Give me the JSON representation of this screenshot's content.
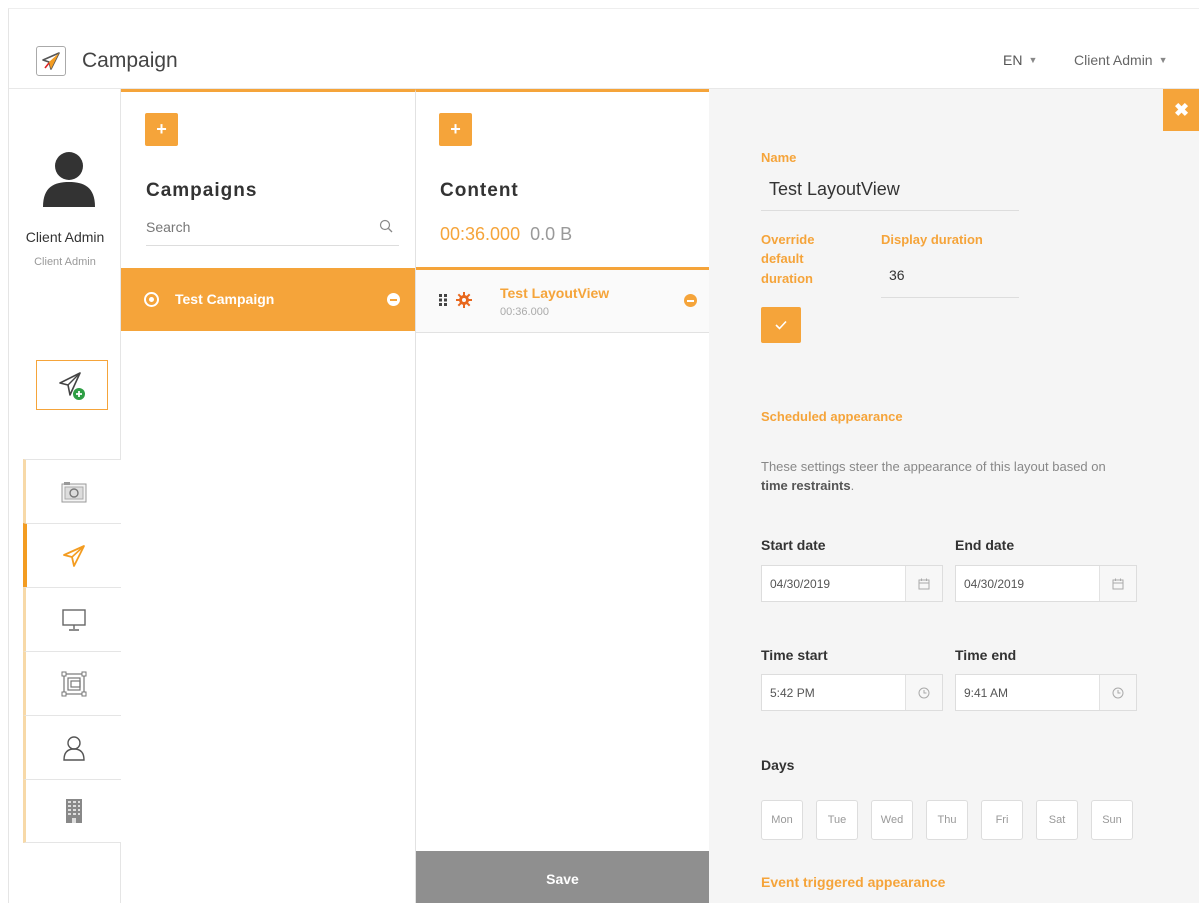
{
  "header": {
    "app_title": "Campaign",
    "language": "EN",
    "user_menu": "Client Admin"
  },
  "sidebar": {
    "user_name": "Client Admin",
    "user_role": "Client Admin",
    "nav_items": [
      "camera-icon",
      "campaign-plane-icon",
      "monitor-icon",
      "layout-icon",
      "user-icon",
      "building-icon"
    ],
    "active_item": "campaign-plane-icon"
  },
  "campaigns": {
    "title": "Campaigns",
    "search_placeholder": "Search",
    "items": [
      {
        "label": "Test Campaign",
        "selected": true
      }
    ]
  },
  "content": {
    "title": "Content",
    "total_duration": "00:36.000",
    "total_size": "0.0 B",
    "items": [
      {
        "title": "Test LayoutView",
        "duration": "00:36.000"
      }
    ],
    "save_label": "Save"
  },
  "panel": {
    "name_label": "Name",
    "name_value": "Test LayoutView",
    "override_label_1": "Override",
    "override_label_2": "default",
    "override_label_3": "duration",
    "override_checked": true,
    "display_duration_label": "Display duration",
    "display_duration_value": "36",
    "scheduled_heading": "Scheduled appearance",
    "description_part1": "These settings steer the appearance of this layout based on ",
    "description_bold": "time restraints",
    "description_end": ".",
    "start_date_label": "Start date",
    "start_date_value": "04/30/2019",
    "end_date_label": "End date",
    "end_date_value": "04/30/2019",
    "time_start_label": "Time start",
    "time_start_value": "5:42 PM",
    "time_end_label": "Time end",
    "time_end_value": "9:41 AM",
    "days_label": "Days",
    "days": [
      "Mon",
      "Tue",
      "Wed",
      "Thu",
      "Fri",
      "Sat",
      "Sun"
    ],
    "event_heading": "Event triggered appearance"
  },
  "colors": {
    "accent": "#f5a43a",
    "save_button": "#8f8f8f",
    "panel_bg": "#f5f5f5"
  }
}
